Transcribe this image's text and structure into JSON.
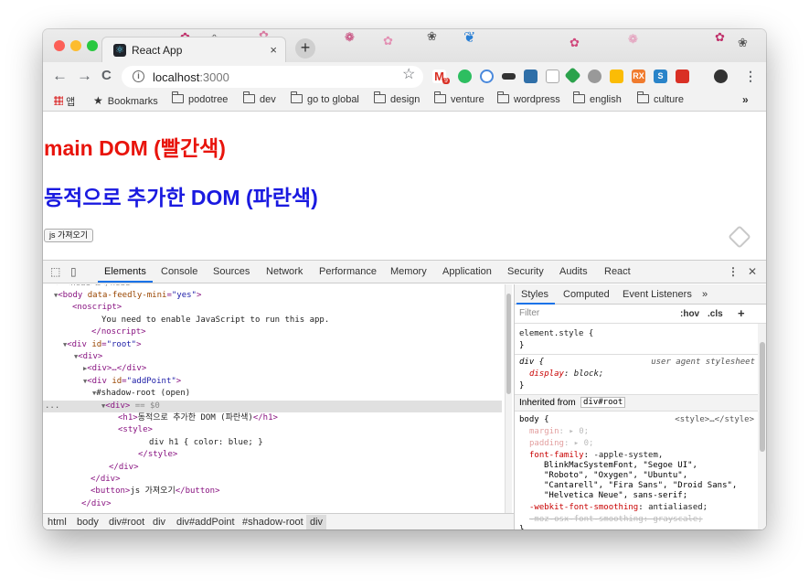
{
  "tab": {
    "title": "React App",
    "close": "×",
    "new_tab": "+"
  },
  "toolbar": {
    "back": "←",
    "forward": "→",
    "reload": "C",
    "url_host": "localhost",
    "url_port": ":3000",
    "info": "i",
    "star": "☆",
    "gmail_badge": "9",
    "menu": "⋮"
  },
  "bookmarks": {
    "apps_label": "앱",
    "items": [
      "Bookmarks",
      "podotree",
      "dev",
      "go to global",
      "design",
      "venture",
      "wordpress",
      "english",
      "culture"
    ],
    "more": "»"
  },
  "page": {
    "heading_red": "main DOM (빨간색)",
    "heading_blue": "동적으로 추가한 DOM (파란색)",
    "button": "js 가져오기"
  },
  "devtools": {
    "tabs": [
      "Elements",
      "Console",
      "Sources",
      "Network",
      "Performance",
      "Memory",
      "Application",
      "Security",
      "Audits",
      "React"
    ],
    "more": "⋮",
    "close": "✕",
    "elements": {
      "body_tag": "<body",
      "body_attr": "data-feedly-mini",
      "body_val": "\"yes\"",
      "noscript_open": "<noscript>",
      "noscript_text": "You need to enable JavaScript to run this app.",
      "noscript_close": "</noscript>",
      "div_root_tag": "<div",
      "div_root_attr": "id",
      "div_root_val": "\"root\"",
      "div_open": "<div>",
      "div_collapsed": "<div>…</div>",
      "div_addpoint_attr": "id",
      "div_addpoint_val": "\"addPoint\"",
      "shadow_root": "#shadow-root (open)",
      "sel_div": "<div>",
      "sel_marker": "== $0",
      "h1_open": "<h1>",
      "h1_text": "동적으로 추가한 DOM (파란색)",
      "h1_close": "</h1>",
      "style_open": "<style>",
      "style_text": "div h1 { color: blue; }",
      "style_close": "</style>",
      "div_close": "</div>",
      "button_open": "<button>",
      "button_text": "js 가져오기",
      "button_close": "</button>",
      "ellipsis": "..."
    },
    "breadcrumbs": [
      "html",
      "body",
      "div#root",
      "div",
      "div#addPoint",
      "#shadow-root",
      "div"
    ],
    "styles": {
      "tabs": [
        "Styles",
        "Computed",
        "Event Listeners",
        "»"
      ],
      "filter_placeholder": "Filter",
      "hov": ":hov",
      "cls": ".cls",
      "add": "+",
      "element_style": "element.style {",
      "close_brace": "}",
      "div_selector": "div {",
      "user_agent": "user agent stylesheet",
      "display_prop": "display",
      "display_val": "block;",
      "inherited_label": "Inherited from",
      "inherited_chip": "div#root",
      "body_selector": "body {",
      "style_source": "<style>…</style>",
      "margin_prop": "margin",
      "margin_val": "▸ 0;",
      "padding_prop": "padding",
      "padding_val": "▸ 0;",
      "font_family_prop": "font-family",
      "font_family_1": "-apple-system,",
      "font_family_2": "BlinkMacSystemFont, \"Segoe UI\",",
      "font_family_3": "\"Roboto\", \"Oxygen\", \"Ubuntu\",",
      "font_family_4": "\"Cantarell\", \"Fira Sans\", \"Droid Sans\",",
      "font_family_5": "\"Helvetica Neue\", sans-serif;",
      "webkit_prop": "-webkit-font-smoothing",
      "webkit_val": "antialiased;",
      "moz_prop": "-moz-osx-font-smoothing",
      "moz_val": "grayscale;"
    }
  },
  "colors": {
    "heading_red": "#e8140c",
    "heading_blue": "#1a1ae0",
    "tag": "#881280",
    "attr_name": "#994500",
    "attr_value": "#1a1aa6",
    "accent": "#1a73e8"
  }
}
